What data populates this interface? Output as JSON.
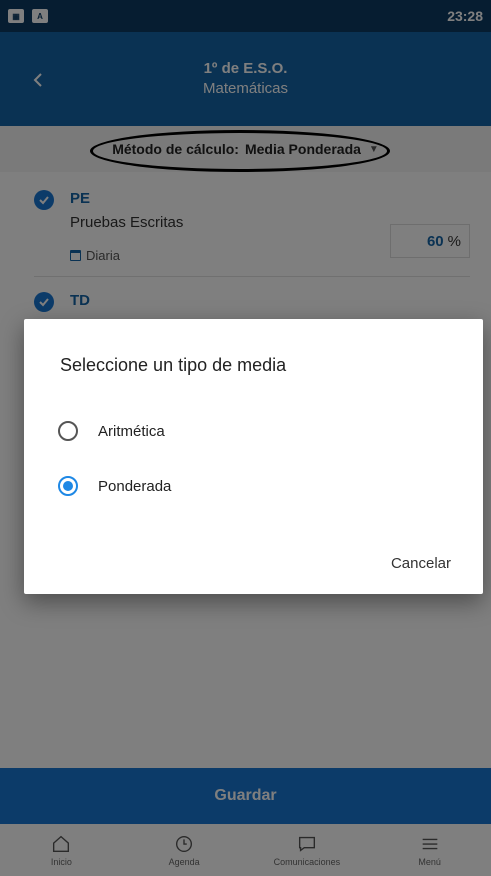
{
  "status_bar": {
    "time": "23:28"
  },
  "header": {
    "course": "1º de E.S.O.",
    "subject": "Matemáticas"
  },
  "method": {
    "label": "Método de cálculo:",
    "value": "Media Ponderada"
  },
  "items": [
    {
      "code": "PE",
      "name": "Pruebas Escritas",
      "frequency": "Diaria",
      "percent": "60",
      "percent_unit": "%"
    },
    {
      "code": "TD"
    }
  ],
  "save_label": "Guardar",
  "bottom_nav": [
    {
      "label": "Inicio",
      "icon": "home-icon"
    },
    {
      "label": "Agenda",
      "icon": "clock-icon"
    },
    {
      "label": "Comunicaciones",
      "icon": "chat-icon"
    },
    {
      "label": "Menú",
      "icon": "menu-icon"
    }
  ],
  "dialog": {
    "title": "Seleccione un tipo de media",
    "options": [
      {
        "label": "Aritmética",
        "selected": false
      },
      {
        "label": "Ponderada",
        "selected": true
      }
    ],
    "cancel_label": "Cancelar"
  },
  "colors": {
    "primary": "#1565a7",
    "accent": "#1e88e5",
    "status_bar": "#0c3a63"
  }
}
